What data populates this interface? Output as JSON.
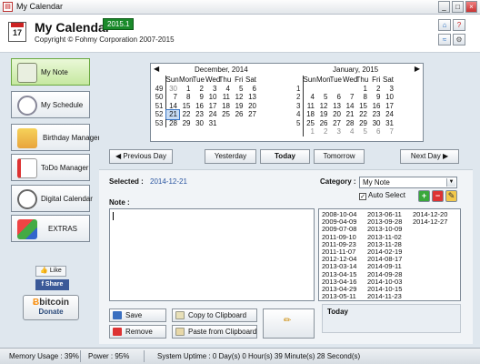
{
  "window": {
    "title": "My Calendar"
  },
  "header": {
    "logo_day": "17",
    "app_name": "My Calendar",
    "version": "2015.1",
    "copyright": "Copyright © Fohmy Corporation 2007-2015"
  },
  "sidebar": {
    "items": [
      {
        "label": "My Note"
      },
      {
        "label": "My Schedule"
      },
      {
        "label": "Birthday Manager"
      },
      {
        "label": "ToDo Manager"
      },
      {
        "label": "Digital Calendar"
      },
      {
        "label": "EXTRAS"
      }
    ],
    "like_label": "Like",
    "share_label": "Share",
    "bitcoin_prefix": "bitcoin",
    "bitcoin_label": "Donate"
  },
  "calendar": {
    "left_month": "December, 2014",
    "right_month": "January, 2015",
    "day_headers": [
      "Sun",
      "Mon",
      "Tue",
      "Wed",
      "Thu",
      "Fri",
      "Sat"
    ],
    "left_weeks": [
      {
        "wk": "49",
        "days": [
          "30",
          "1",
          "2",
          "3",
          "4",
          "5",
          "6"
        ]
      },
      {
        "wk": "50",
        "days": [
          "7",
          "8",
          "9",
          "10",
          "11",
          "12",
          "13"
        ]
      },
      {
        "wk": "51",
        "days": [
          "14",
          "15",
          "16",
          "17",
          "18",
          "19",
          "20"
        ]
      },
      {
        "wk": "52",
        "days": [
          "21",
          "22",
          "23",
          "24",
          "25",
          "26",
          "27"
        ]
      },
      {
        "wk": "53",
        "days": [
          "28",
          "29",
          "30",
          "31",
          "",
          "",
          ""
        ]
      }
    ],
    "right_weeks": [
      {
        "wk": "1",
        "days": [
          "",
          "",
          "",
          "",
          "1",
          "2",
          "3"
        ]
      },
      {
        "wk": "2",
        "days": [
          "4",
          "5",
          "6",
          "7",
          "8",
          "9",
          "10"
        ]
      },
      {
        "wk": "3",
        "days": [
          "11",
          "12",
          "13",
          "14",
          "15",
          "16",
          "17"
        ]
      },
      {
        "wk": "4",
        "days": [
          "18",
          "19",
          "20",
          "21",
          "22",
          "23",
          "24"
        ]
      },
      {
        "wk": "5",
        "days": [
          "25",
          "26",
          "27",
          "28",
          "29",
          "30",
          "31"
        ]
      },
      {
        "wk": "",
        "days": [
          "1",
          "2",
          "3",
          "4",
          "5",
          "6",
          "7"
        ]
      }
    ]
  },
  "nav": {
    "previous_day": "Previous Day",
    "yesterday": "Yesterday",
    "today": "Today",
    "tomorrow": "Tomorrow",
    "next_day": "Next Day"
  },
  "note": {
    "selected_label": "Selected :",
    "selected_value": "2014-12-21",
    "note_label": "Note :",
    "category_label": "Category :",
    "category_value": "My Note",
    "auto_select_label": "Auto Select",
    "auto_select_checked": "✓"
  },
  "dates": [
    [
      "2008-10-04",
      "2009-04-09",
      "2009-07-08",
      "2011-09-10",
      "2011-09-23",
      "2011-11-07",
      "2012-12-04",
      "2013-03-14",
      "2013-04-15",
      "2013-04-16",
      "2013-04-29",
      "2013-05-11"
    ],
    [
      "2013-06-11",
      "2013-09-28",
      "2013-10-09",
      "2013-11-02",
      "2013-11-28",
      "2014-02-19",
      "2014-08-17",
      "2014-09-11",
      "2014-09-28",
      "2014-10-03",
      "2014-10-15",
      "2014-11-23"
    ],
    [
      "2014-12-20",
      "2014-12-27"
    ]
  ],
  "actions": {
    "save": "Save",
    "remove": "Remove",
    "copy": "Copy to Clipboard",
    "paste": "Paste from Clipboard"
  },
  "today_box": {
    "label": "Today"
  },
  "status": {
    "memory": "Memory Usage : 39%",
    "power": "Power : 95%",
    "uptime": "System Uptime : 0 Day(s) 0 Hour(s) 39 Minute(s) 28 Second(s)"
  }
}
